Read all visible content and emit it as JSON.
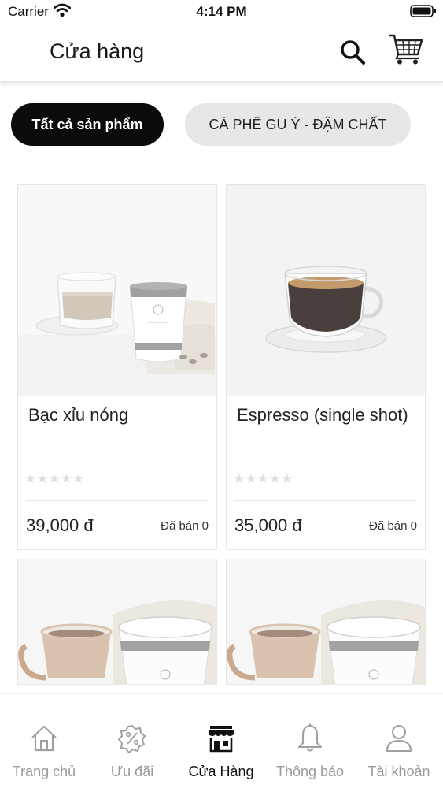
{
  "status_bar": {
    "carrier": "Carrier",
    "time": "4:14 PM"
  },
  "header": {
    "title": "Cửa hàng"
  },
  "categories": [
    {
      "label": "Tất cả sản phẩm",
      "selected": true
    },
    {
      "label": "CÀ PHÊ GU Ý - ĐẬM CHẤT",
      "selected": false
    }
  ],
  "products": [
    {
      "name": "Bạc xỉu nóng",
      "price": "39,000 đ",
      "sold": "Đã bán 0",
      "rating": 0,
      "image_icon": "glass-and-paper-cup-image"
    },
    {
      "name": "Espresso (single shot)",
      "price": "35,000 đ",
      "sold": "Đã bán 0",
      "rating": 0,
      "image_icon": "espresso-cup-image"
    },
    {
      "name": "",
      "price": "",
      "sold": "",
      "image_icon": "ceramic-cup-and-paper-cup-image"
    },
    {
      "name": "",
      "price": "",
      "sold": "",
      "image_icon": "ceramic-cup-and-paper-cup-image"
    }
  ],
  "tab_bar": {
    "items": [
      {
        "label": "Trang chủ",
        "icon": "home-icon",
        "active": false
      },
      {
        "label": "Ưu đãi",
        "icon": "discount-badge-icon",
        "active": false
      },
      {
        "label": "Cửa Hàng",
        "icon": "store-icon",
        "active": true
      },
      {
        "label": "Thông báo",
        "icon": "bell-icon",
        "active": false
      },
      {
        "label": "Tài khoản",
        "icon": "user-icon",
        "active": false
      }
    ]
  },
  "colors": {
    "accent": "#0b0b0b",
    "chip_inactive": "#e7e7e7",
    "tab_inactive": "#9a9a9a",
    "stars": "#dedede"
  }
}
